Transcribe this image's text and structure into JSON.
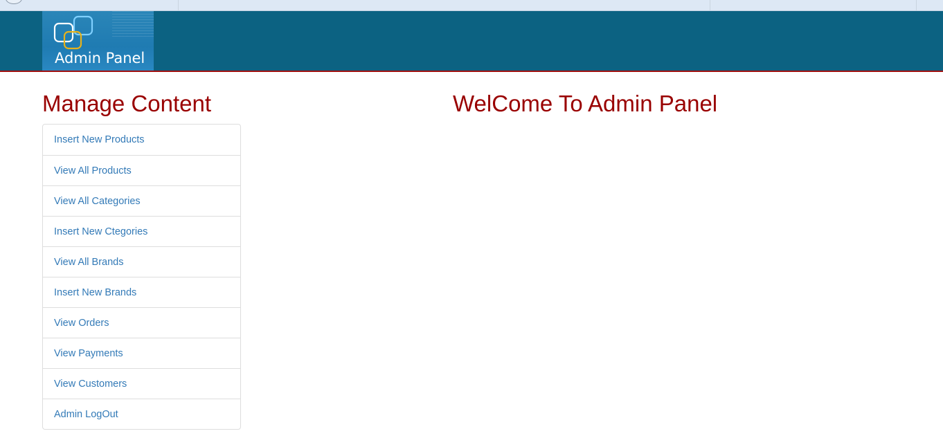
{
  "header": {
    "logo_text": "Admin Panel",
    "background_color": "#0c6282",
    "accent_border_color": "#a01010"
  },
  "sidebar": {
    "title": "Manage Content",
    "link_color": "#337ab7",
    "items": [
      {
        "label": "Insert New Products"
      },
      {
        "label": "View All Products"
      },
      {
        "label": "View All Categories"
      },
      {
        "label": "Insert New Ctegories"
      },
      {
        "label": "View All Brands"
      },
      {
        "label": "Insert New Brands"
      },
      {
        "label": "View Orders"
      },
      {
        "label": "View Payments"
      },
      {
        "label": "View Customers"
      },
      {
        "label": "Admin LogOut"
      }
    ]
  },
  "main": {
    "title": "WelCome To Admin Panel",
    "title_color": "#990000"
  }
}
